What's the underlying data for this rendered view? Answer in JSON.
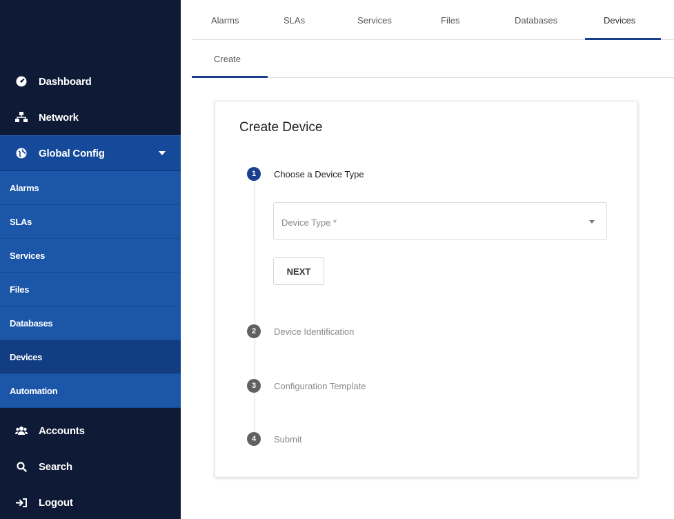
{
  "top_tabs": [
    {
      "label": "Alarms"
    },
    {
      "label": "SLAs"
    },
    {
      "label": "Services"
    },
    {
      "label": "Files"
    },
    {
      "label": "Databases"
    },
    {
      "label": "Devices"
    }
  ],
  "active_tab": "Devices",
  "sub_tabs": [
    {
      "label": "Create"
    }
  ],
  "sidebar": {
    "top_items": [
      {
        "label": "Dashboard",
        "icon": "dashboard-icon"
      },
      {
        "label": "Network",
        "icon": "network-icon"
      },
      {
        "label": "Global Config",
        "icon": "globe-icon"
      }
    ],
    "sub_items": [
      {
        "label": "Alarms"
      },
      {
        "label": "SLAs"
      },
      {
        "label": "Services"
      },
      {
        "label": "Files"
      },
      {
        "label": "Databases"
      },
      {
        "label": "Devices"
      },
      {
        "label": "Automation"
      }
    ],
    "bottom_items": [
      {
        "label": "Accounts",
        "icon": "accounts-icon"
      },
      {
        "label": "Search",
        "icon": "search-icon"
      },
      {
        "label": "Logout",
        "icon": "logout-icon"
      }
    ]
  },
  "card": {
    "title": "Create Device",
    "steps": [
      {
        "number": "1",
        "label": "Choose a Device Type"
      },
      {
        "number": "2",
        "label": "Device Identification"
      },
      {
        "number": "3",
        "label": "Configuration Template"
      },
      {
        "number": "4",
        "label": "Submit"
      }
    ],
    "device_type_placeholder": "Device Type *",
    "next_label": "NEXT"
  },
  "colors": {
    "sidebar_bg": "#0f1a36",
    "sidebar_active": "#15499a",
    "accent": "#1b3f8f"
  }
}
